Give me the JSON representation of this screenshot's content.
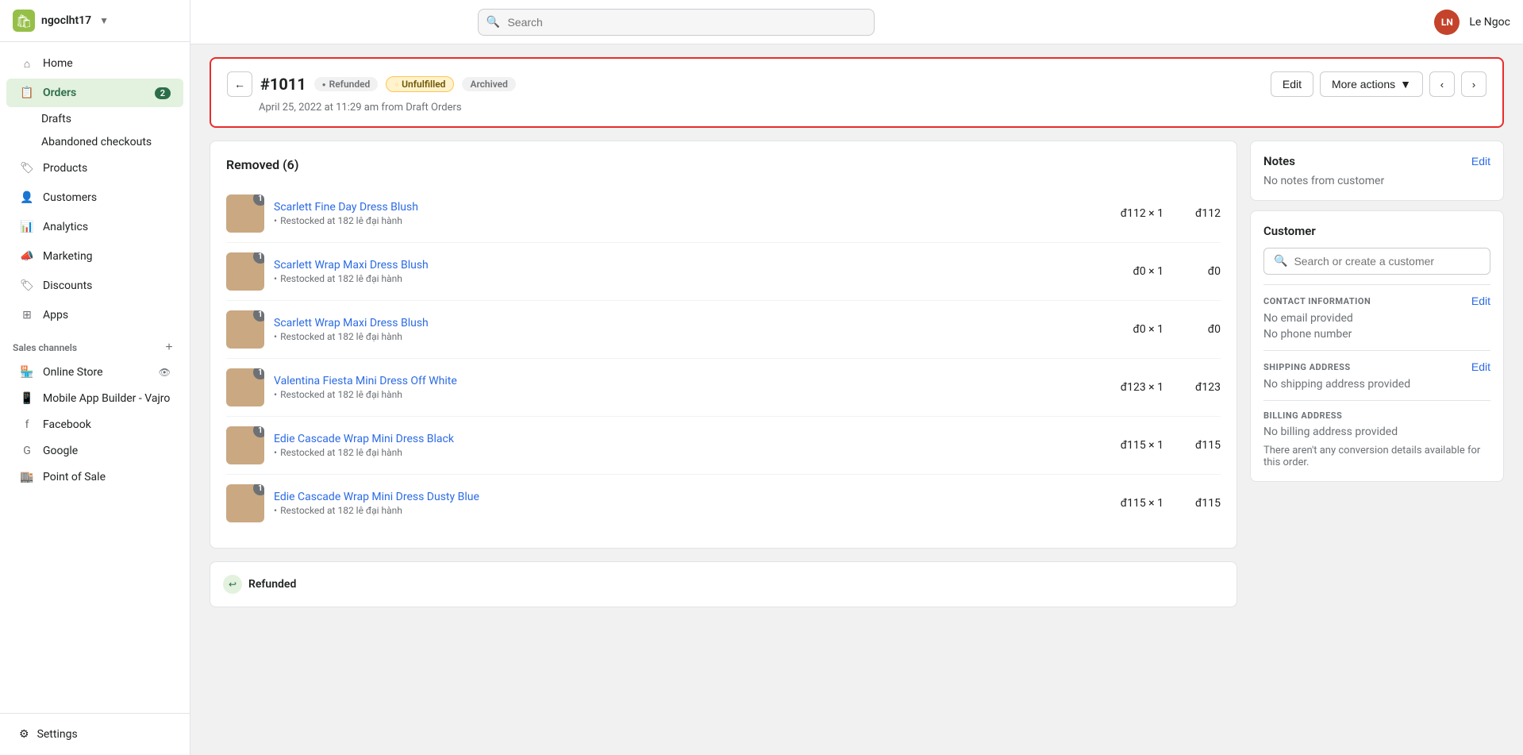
{
  "store": {
    "name": "ngoclht17",
    "logo_char": "S"
  },
  "topbar": {
    "search_placeholder": "Search",
    "user_initials": "LN",
    "user_name": "Le Ngoc"
  },
  "sidebar": {
    "nav_items": [
      {
        "id": "home",
        "label": "Home",
        "icon": "home",
        "active": false
      },
      {
        "id": "orders",
        "label": "Orders",
        "icon": "orders",
        "active": true,
        "badge": "2"
      },
      {
        "id": "products",
        "label": "Products",
        "icon": "products",
        "active": false
      },
      {
        "id": "customers",
        "label": "Customers",
        "icon": "customers",
        "active": false
      },
      {
        "id": "analytics",
        "label": "Analytics",
        "icon": "analytics",
        "active": false
      },
      {
        "id": "marketing",
        "label": "Marketing",
        "icon": "marketing",
        "active": false
      },
      {
        "id": "discounts",
        "label": "Discounts",
        "icon": "discounts",
        "active": false
      },
      {
        "id": "apps",
        "label": "Apps",
        "icon": "apps",
        "active": false
      }
    ],
    "sub_items": [
      {
        "id": "drafts",
        "label": "Drafts"
      },
      {
        "id": "abandoned",
        "label": "Abandoned checkouts"
      }
    ],
    "sales_channels_title": "Sales channels",
    "sales_channels": [
      {
        "id": "online-store",
        "label": "Online Store",
        "has_eye": true
      },
      {
        "id": "mobile-app",
        "label": "Mobile App Builder - Vajro",
        "has_eye": false
      },
      {
        "id": "facebook",
        "label": "Facebook",
        "has_eye": false
      },
      {
        "id": "google",
        "label": "Google",
        "has_eye": false
      },
      {
        "id": "pos",
        "label": "Point of Sale",
        "has_eye": false
      }
    ],
    "settings_label": "Settings"
  },
  "order": {
    "number": "#1011",
    "status_refunded": "Refunded",
    "status_unfulfilled": "Unfulfilled",
    "status_archived": "Archived",
    "date": "April 25, 2022 at 11:29 am from Draft Orders",
    "edit_label": "Edit",
    "more_actions_label": "More actions"
  },
  "removed_section": {
    "title": "Removed (6)",
    "products": [
      {
        "id": 1,
        "name": "Scarlett Fine Day Dress Blush",
        "sub": "Restocked at 182 lê đại hành",
        "qty_price": "đ112 × 1",
        "total": "đ112",
        "qty_badge": "1",
        "color": "#c9a882"
      },
      {
        "id": 2,
        "name": "Scarlett Wrap Maxi Dress Blush",
        "sub": "Restocked at 182 lê đại hành",
        "qty_price": "đ0 × 1",
        "total": "đ0",
        "qty_badge": "1",
        "color": "#b8909a"
      },
      {
        "id": 3,
        "name": "Scarlett Wrap Maxi Dress Blush",
        "sub": "Restocked at 182 lê đại hành",
        "qty_price": "đ0 × 1",
        "total": "đ0",
        "qty_badge": "1",
        "color": "#c47a6a"
      },
      {
        "id": 4,
        "name": "Valentina Fiesta Mini Dress Off White",
        "sub": "Restocked at 182 lê đại hành",
        "qty_price": "đ123 × 1",
        "total": "đ123",
        "qty_badge": "1",
        "color": "#d4b896"
      },
      {
        "id": 5,
        "name": "Edie Cascade Wrap Mini Dress Black",
        "sub": "Restocked at 182 lê đại hành",
        "qty_price": "đ115 × 1",
        "total": "đ115",
        "qty_badge": "1",
        "color": "#7a6a5a"
      },
      {
        "id": 6,
        "name": "Edie Cascade Wrap Mini Dress Dusty Blue",
        "sub": "Restocked at 182 lê đại hành",
        "qty_price": "đ115 × 1",
        "total": "đ115",
        "qty_badge": "1",
        "color": "#9aacba"
      }
    ]
  },
  "right_panel": {
    "notes": {
      "title": "Notes",
      "edit_label": "Edit",
      "content": "No notes from customer"
    },
    "customer": {
      "title": "Customer",
      "search_placeholder": "Search or create a customer"
    },
    "contact": {
      "label": "CONTACT INFORMATION",
      "edit_label": "Edit",
      "email": "No email provided",
      "phone": "No phone number"
    },
    "shipping": {
      "label": "SHIPPING ADDRESS",
      "edit_label": "Edit",
      "value": "No shipping address provided"
    },
    "billing": {
      "label": "BILLING ADDRESS",
      "value": "No billing address provided"
    },
    "conversion_note": "There aren't any conversion details available for this order."
  },
  "refunded_bottom": {
    "label": "Refunded"
  }
}
